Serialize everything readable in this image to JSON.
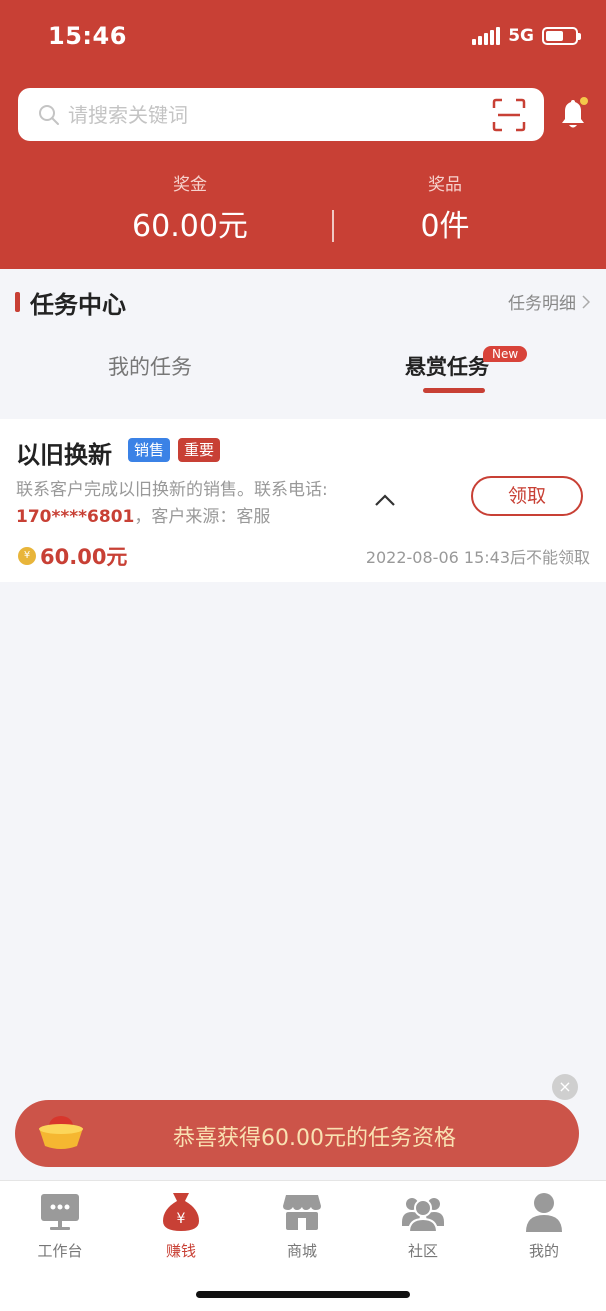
{
  "status_bar": {
    "time": "15:46",
    "network": "5G"
  },
  "search": {
    "placeholder": "请搜索关键词"
  },
  "stats": {
    "bonus_label": "奖金",
    "bonus_value": "60.00元",
    "prize_label": "奖品",
    "prize_value": "0件"
  },
  "task_center": {
    "title": "任务中心",
    "detail_link": "任务明细",
    "tabs": [
      {
        "label": "我的任务",
        "active": false
      },
      {
        "label": "悬赏任务",
        "active": true,
        "badge": "New"
      }
    ]
  },
  "task_card": {
    "title": "以旧换新",
    "tags": [
      "销售",
      "重要"
    ],
    "desc_prefix": "联系客户完成以旧换新的销售。联系电话:",
    "phone": "170****6801",
    "desc_suffix": "，客户来源：客服",
    "claim_label": "领取",
    "reward": "60.00元",
    "deadline": "2022-08-06 15:43后不能领取"
  },
  "toast": {
    "text": "恭喜获得60.00元的任务资格"
  },
  "tabbar": {
    "items": [
      {
        "label": "工作台",
        "icon": "workbench-icon",
        "active": false
      },
      {
        "label": "赚钱",
        "icon": "money-bag-icon",
        "active": true
      },
      {
        "label": "商城",
        "icon": "shop-icon",
        "active": false
      },
      {
        "label": "社区",
        "icon": "community-icon",
        "active": false
      },
      {
        "label": "我的",
        "icon": "profile-icon",
        "active": false
      }
    ]
  },
  "colors": {
    "brand": "#c84035",
    "blue_tag": "#3b82e6",
    "toast_text": "#f9e1b2"
  }
}
